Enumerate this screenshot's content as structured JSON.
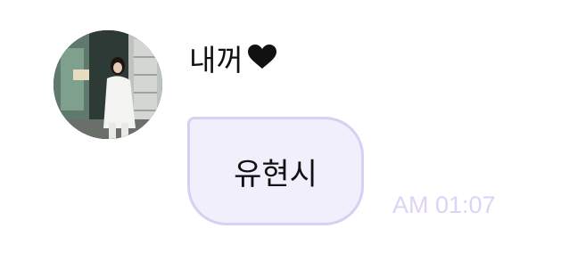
{
  "message": {
    "sender_name": "내꺼",
    "sender_suffix_icon": "heart-icon",
    "avatar_icon": "profile-photo",
    "text": "유현시",
    "time": "AM 01:07"
  },
  "colors": {
    "bubble_fill": "#f2effc",
    "bubble_border": "#d9cff3",
    "timestamp": "#ddd3f5",
    "text": "#111111"
  }
}
